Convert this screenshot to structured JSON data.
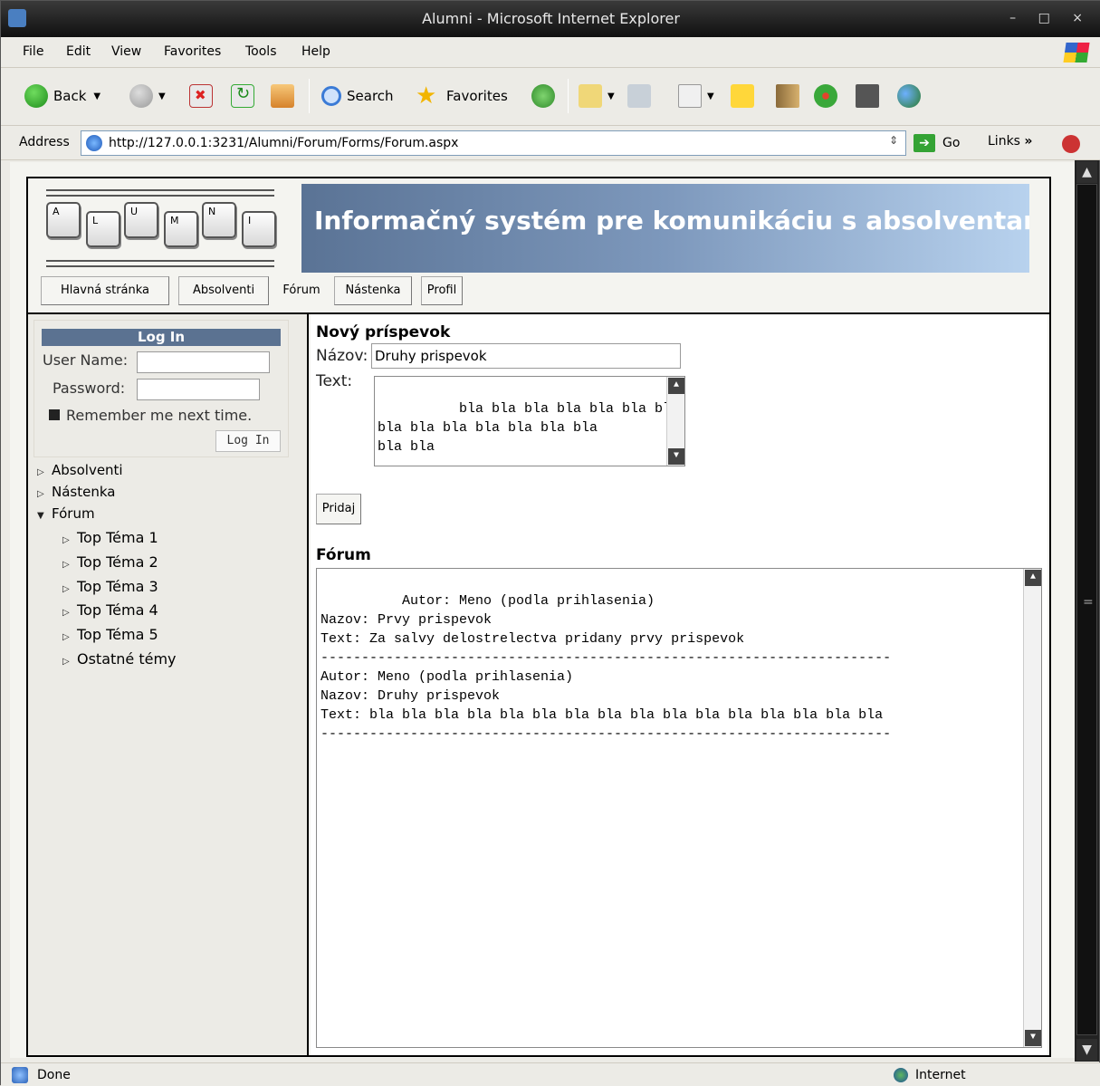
{
  "window": {
    "title": "Alumni - Microsoft Internet Explorer",
    "controls": "– □ ×"
  },
  "menu": [
    "File",
    "Edit",
    "View",
    "Favorites",
    "Tools",
    "Help"
  ],
  "toolbar": {
    "back": "Back",
    "search": "Search",
    "favorites": "Favorites"
  },
  "address": {
    "label": "Address",
    "url": "http://127.0.0.1:3231/Alumni/Forum/Forms/Forum.aspx",
    "go": "Go",
    "links": "Links"
  },
  "header": {
    "logo_letters": [
      "A",
      "L",
      "U",
      "M",
      "N",
      "I"
    ],
    "banner": "Informačný systém pre komunikáciu s absolventami",
    "nav": [
      "Hlavná stránka",
      "Absolventi",
      "Fórum",
      "Nástenka",
      "Profil"
    ]
  },
  "login": {
    "title": "Log In",
    "username_label": "User Name:",
    "password_label": "Password:",
    "remember": "Remember me next time.",
    "button": "Log In"
  },
  "tree": {
    "items": [
      "Absolventi",
      "Nástenka",
      "Fórum"
    ],
    "subitems": [
      "Top Téma 1",
      "Top Téma 2",
      "Top Téma 3",
      "Top Téma 4",
      "Top Téma 5",
      "Ostatné témy"
    ]
  },
  "new_post": {
    "heading": "Nový príspevok",
    "title_label": "Názov:",
    "title_value": "Druhy prispevok",
    "text_label": "Text:",
    "text_value": "bla bla bla bla bla bla bla\nbla bla bla bla bla bla bla\nbla bla",
    "submit": "Pridaj"
  },
  "forum": {
    "heading": "Fórum",
    "content": "Autor: Meno (podla prihlasenia)\nNazov: Prvy prispevok\nText: Za salvy delostrelectva pridany prvy prispevok\n----------------------------------------------------------------------\nAutor: Meno (podla prihlasenia)\nNazov: Druhy prispevok\nText: bla bla bla bla bla bla bla bla bla bla bla bla bla bla bla bla\n----------------------------------------------------------------------"
  },
  "status": {
    "left": "Done",
    "zone": "Internet"
  }
}
